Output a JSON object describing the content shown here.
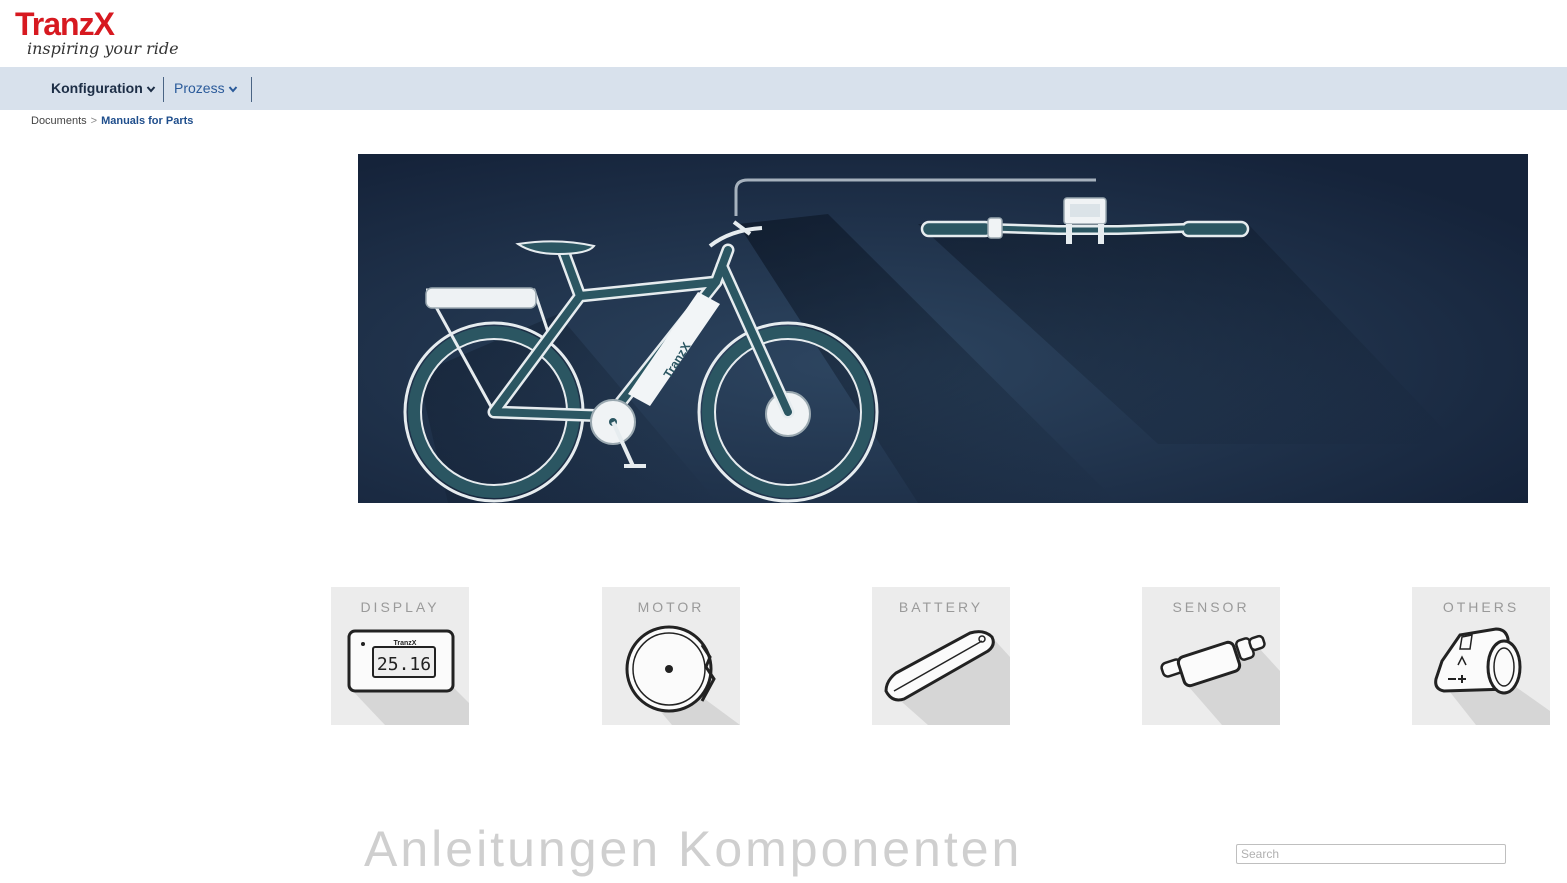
{
  "logo": {
    "brand": "TranzX",
    "tagline": "inspiring your ride"
  },
  "nav": {
    "items": [
      {
        "label": "Konfiguration"
      },
      {
        "label": "Prozess"
      }
    ]
  },
  "breadcrumb": {
    "root": "Documents",
    "separator": ">",
    "current": "Manuals for Parts"
  },
  "banner": {
    "frame_brand": "TranzX"
  },
  "categories": [
    {
      "label": "DISPLAY",
      "icon": "display-icon",
      "display_value": "25.16",
      "device_brand": "TranzX"
    },
    {
      "label": "MOTOR",
      "icon": "motor-icon"
    },
    {
      "label": "BATTERY",
      "icon": "battery-icon"
    },
    {
      "label": "SENSOR",
      "icon": "sensor-icon"
    },
    {
      "label": "OTHERS",
      "icon": "others-icon"
    }
  ],
  "heading": "Anleitungen Komponenten",
  "search": {
    "placeholder": "Search",
    "value": ""
  },
  "colors": {
    "brand_red": "#d71920",
    "nav_bg": "#d8e1ec",
    "banner_bg": "#1a2a3f",
    "bike_teal": "#2b5662",
    "tile_bg": "#ececec"
  }
}
